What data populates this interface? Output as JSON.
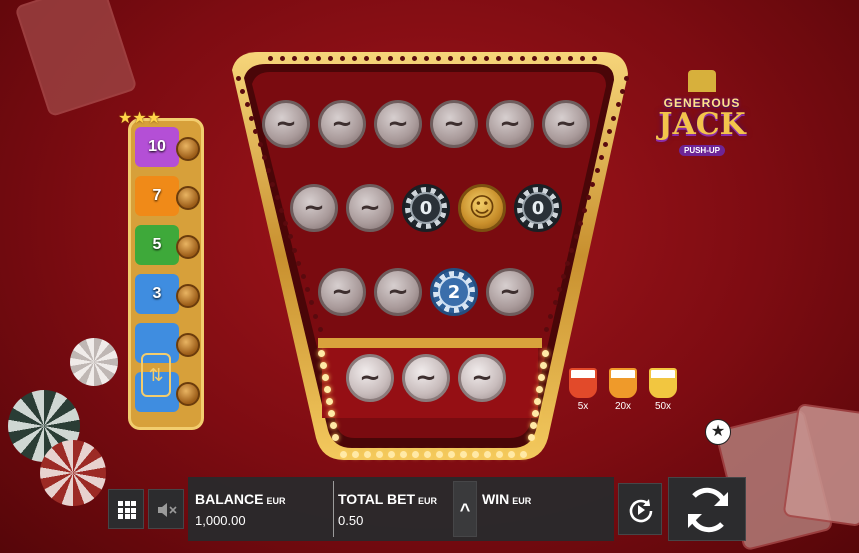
{
  "logo": {
    "line1": "GENEROUS",
    "line2": "JACK",
    "line3": "PUSH-UP"
  },
  "colors": {
    "accent_gold": "#e2b04a",
    "table_red": "#8e0f15",
    "bar_bg": "#2a2a2c"
  },
  "board": {
    "rows": [
      [
        {
          "t": "empty",
          "label": "~"
        },
        {
          "t": "empty",
          "label": "~"
        },
        {
          "t": "empty",
          "label": "~"
        },
        {
          "t": "empty",
          "label": "~"
        },
        {
          "t": "empty",
          "label": "~"
        },
        {
          "t": "empty",
          "label": "~"
        }
      ],
      [
        {
          "t": "empty",
          "label": "~"
        },
        {
          "t": "empty",
          "label": "~"
        },
        {
          "t": "dark",
          "label": "0"
        },
        {
          "t": "gold",
          "label": "☺"
        },
        {
          "t": "dark",
          "label": "0"
        }
      ],
      [
        {
          "t": "empty",
          "label": "~"
        },
        {
          "t": "empty",
          "label": "~"
        },
        {
          "t": "blue",
          "label": "2"
        },
        {
          "t": "empty",
          "label": "~"
        }
      ],
      [
        {
          "t": "empty-w",
          "label": "~"
        },
        {
          "t": "empty-w",
          "label": "~"
        },
        {
          "t": "empty-w",
          "label": "~"
        }
      ]
    ]
  },
  "ladder": {
    "rungs": [
      "10",
      "7",
      "5",
      "3",
      "",
      ""
    ],
    "rung_colors": [
      "#b44fd6",
      "#f08a18",
      "#3ea93a",
      "#3f8de0",
      "#3f8de0",
      "#3f8de0"
    ]
  },
  "multipliers": [
    {
      "label": "5x",
      "color": "#e24a2a"
    },
    {
      "label": "20x",
      "color": "#ef9a2a"
    },
    {
      "label": "50x",
      "color": "#f2c640"
    }
  ],
  "bottom_bar": {
    "balance_label": "BALANCE",
    "balance_currency": "EUR",
    "balance_value": "1,000.00",
    "bet_label": "TOTAL BET",
    "bet_currency": "EUR",
    "bet_value": "0.50",
    "win_label": "WIN",
    "win_currency": "EUR",
    "up_arrow": "^"
  },
  "icons": {
    "menu": "grid-icon",
    "sound": "sound-muted-icon",
    "autoplay": "autoplay-icon",
    "spin": "spin-icon",
    "favorite": "star-icon"
  }
}
